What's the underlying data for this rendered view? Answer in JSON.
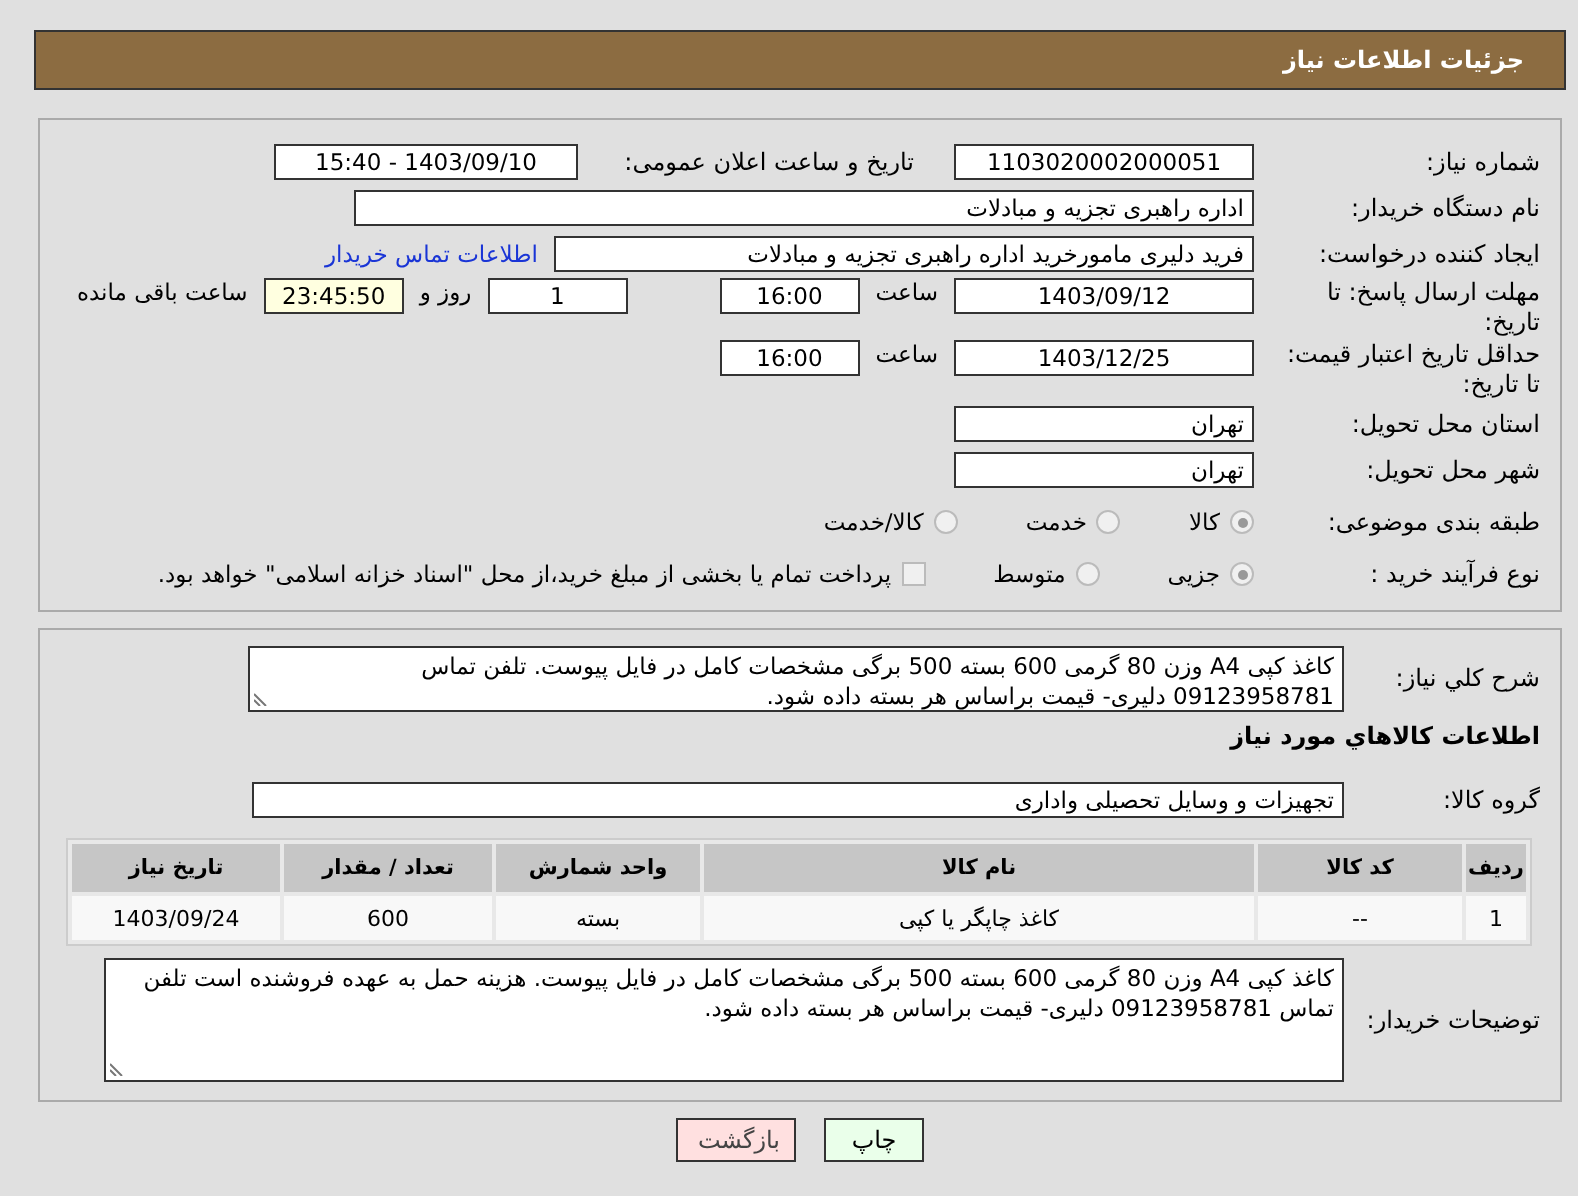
{
  "header": {
    "title": "جزئیات اطلاعات نیاز"
  },
  "need_number": {
    "label": "شماره نیاز:",
    "value": "1103020002000051"
  },
  "announce": {
    "label": "تاریخ و ساعت اعلان عمومی:",
    "value": "1403/09/10 - 15:40"
  },
  "buyer_org": {
    "label": "نام دستگاه خریدار:",
    "value": "اداره راهبری تجزیه و مبادلات"
  },
  "requester": {
    "label": "ایجاد کننده درخواست:",
    "value": "فرید دلیری مامورخرید اداره راهبری تجزیه و مبادلات",
    "link": "اطلاعات تماس خریدار"
  },
  "deadline": {
    "label": "مهلت ارسال پاسخ: تا تاریخ:",
    "date": "1403/09/12",
    "time_label": "ساعت",
    "time": "16:00",
    "days": "1",
    "days_label": "روز و",
    "remaining": "23:45:50",
    "remaining_label": "ساعت باقی مانده"
  },
  "validity": {
    "label": "حداقل تاریخ اعتبار قیمت: تا تاریخ:",
    "date": "1403/12/25",
    "time_label": "ساعت",
    "time": "16:00"
  },
  "province": {
    "label": "استان محل تحویل:",
    "value": "تهران"
  },
  "city": {
    "label": "شهر محل تحویل:",
    "value": "تهران"
  },
  "category": {
    "label": "طبقه بندی موضوعی:",
    "options": [
      {
        "label": "کالا",
        "selected": true
      },
      {
        "label": "خدمت",
        "selected": false
      },
      {
        "label": "کالا/خدمت",
        "selected": false
      }
    ]
  },
  "process": {
    "label": "نوع فرآیند خرید :",
    "options": [
      {
        "label": "جزیی",
        "selected": true
      },
      {
        "label": "متوسط",
        "selected": false
      }
    ],
    "payment": {
      "label": "پرداخت تمام یا بخشی از مبلغ خرید،از محل \"اسناد خزانه اسلامی\" خواهد بود.",
      "checked": false
    }
  },
  "description": {
    "label": "شرح کلي نياز:",
    "value": "کاغذ کپی A4 وزن 80 گرمی 600 بسته 500 برگی مشخصات کامل در فایل پیوست.  تلفن تماس 09123958781 دلیری- قیمت براساس هر بسته داده شود."
  },
  "goods_heading": "اطلاعات کالاهاي مورد نياز",
  "goods_group": {
    "label": "گروه کالا:",
    "value": "تجهیزات و وسایل تحصیلی واداری"
  },
  "table": {
    "columns": [
      "ردیف",
      "کد کالا",
      "نام کالا",
      "واحد شمارش",
      "تعداد / مقدار",
      "تاریخ نیاز"
    ],
    "rows": [
      [
        "1",
        "--",
        "کاغذ چاپگر یا کپی",
        "بسته",
        "600",
        "1403/09/24"
      ]
    ]
  },
  "buyer_notes": {
    "label": "توضیحات خریدار:",
    "value": "کاغذ کپی A4 وزن 80 گرمی 600 بسته 500 برگی مشخصات کامل در فایل پیوست. هزینه حمل به عهده فروشنده است تلفن تماس 09123958781 دلیری- قیمت براساس هر بسته داده شود."
  },
  "buttons": [
    {
      "label": "چاپ",
      "kind": "print"
    },
    {
      "label": "بازگشت",
      "kind": "back"
    }
  ]
}
